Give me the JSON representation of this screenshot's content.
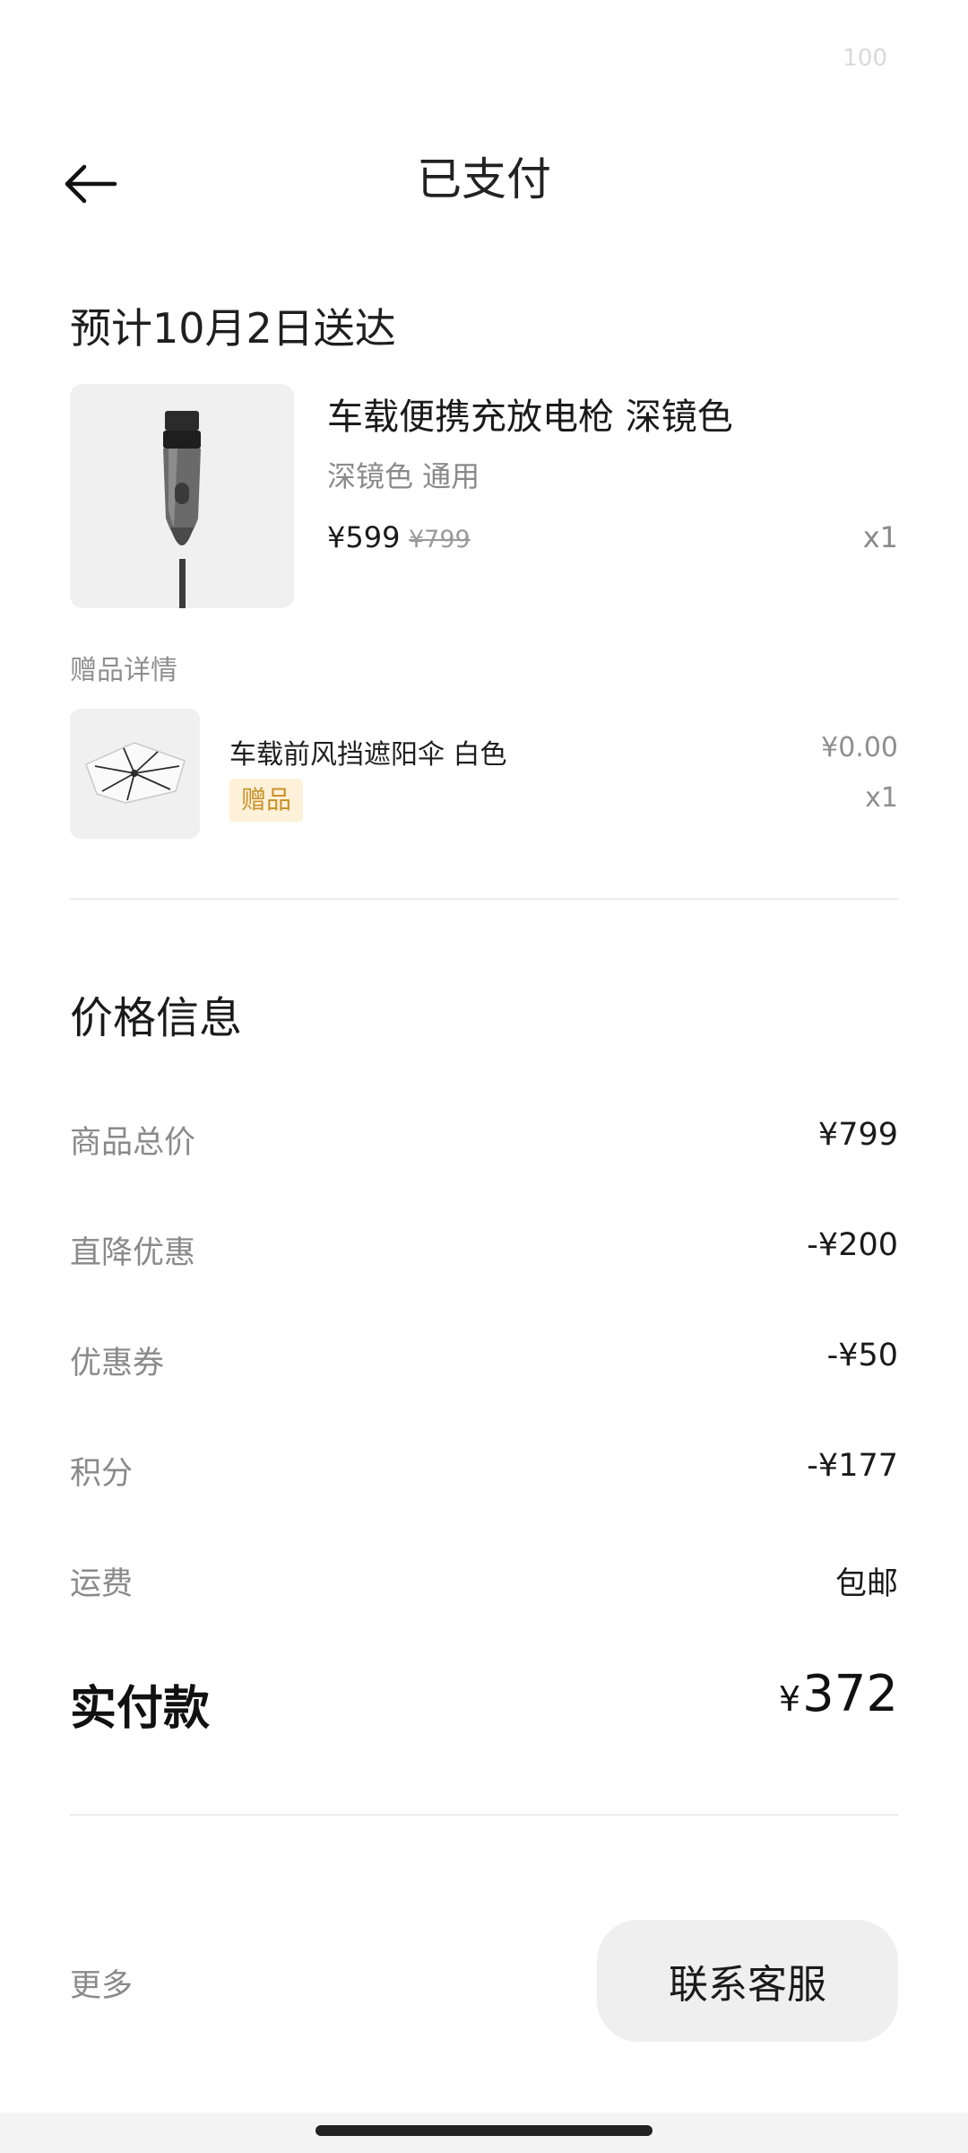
{
  "status": {
    "battery": "100"
  },
  "header": {
    "title": "已支付"
  },
  "delivery": {
    "text": "预计10月2日送达"
  },
  "product": {
    "name": "车载便携充放电枪 深镜色",
    "spec": "深镜色 通用",
    "price": "¥599",
    "original_price": "¥799",
    "quantity": "x1"
  },
  "gift_section": {
    "title": "赠品详情",
    "item": {
      "name": "车载前风挡遮阳伞 白色",
      "badge": "赠品",
      "price": "¥0.00",
      "quantity": "x1"
    }
  },
  "price_info": {
    "title": "价格信息",
    "rows": [
      {
        "label": "商品总价",
        "value": "¥799"
      },
      {
        "label": "直降优惠",
        "value": "-¥200"
      },
      {
        "label": "优惠券",
        "value": "-¥50"
      },
      {
        "label": "积分",
        "value": "-¥177"
      },
      {
        "label": "运费",
        "value": "包邮"
      }
    ],
    "total": {
      "label": "实付款",
      "currency": "¥",
      "amount": "372"
    }
  },
  "footer": {
    "more_label": "更多",
    "contact_label": "联系客服"
  }
}
